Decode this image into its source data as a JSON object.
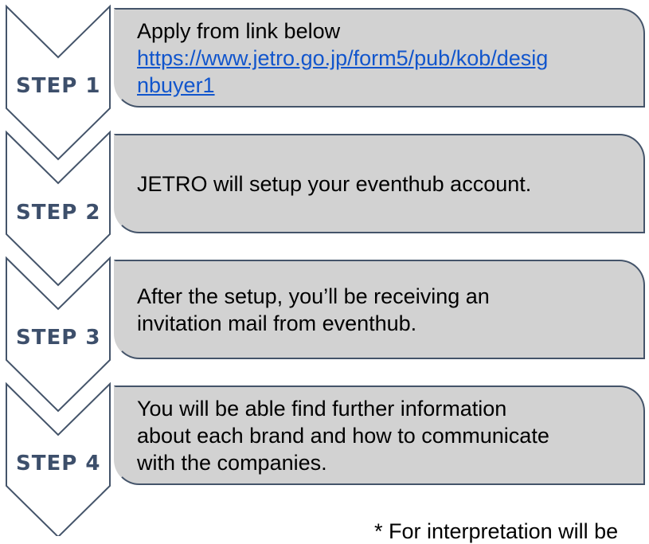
{
  "steps": [
    {
      "label": "STEP 1",
      "line1": "Apply from link below",
      "link_line1": "https://www.jetro.go.jp/form5/pub/kob/desig",
      "link_line2": "nbuyer1"
    },
    {
      "label": "STEP 2",
      "line1": "JETRO will setup your eventhub account."
    },
    {
      "label": "STEP 3",
      "line1": "After the setup, you’ll be receiving an",
      "line2": "invitation mail from eventhub."
    },
    {
      "label": "STEP 4",
      "line1": "You will be able find further information",
      "line2": "about each brand and how to communicate",
      "line3": "with the companies."
    }
  ],
  "footnote": "* For interpretation will be"
}
